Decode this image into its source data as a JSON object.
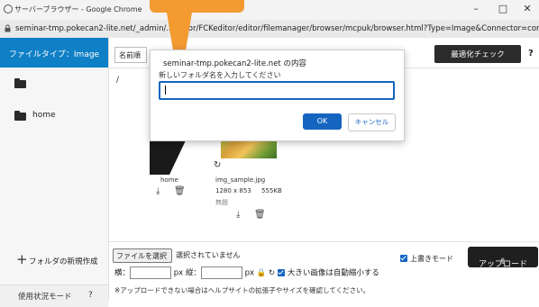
{
  "window": {
    "title": "サーバーブラウザー - Google Chrome",
    "minimize": "–",
    "maximize": "□",
    "close": "✕"
  },
  "urlbar": {
    "url": "seminar-tmp.pokecan2-lite.net/_admin/...editor/FCKeditor/editor/filemanager/browser/mcpuk/browser.html?Type=Image&Connector=con..."
  },
  "sidebar": {
    "filetype_label": "ファイルタイプ：Image",
    "items": [
      {
        "label": ""
      },
      {
        "label": "home"
      }
    ],
    "new_folder": "フォルダの新規作成",
    "usage_mode": "使用状況モード",
    "usage_help": "?"
  },
  "toolbar": {
    "name_label": "名前順",
    "optimize_label": "最適化チェック",
    "help": "?"
  },
  "breadcrumb": "/",
  "files": [
    {
      "name": "home"
    },
    {
      "name": "img_sample.jpg",
      "dimensions": "1280 x 853",
      "size": "555KB",
      "note": "無題"
    }
  ],
  "dialog": {
    "title": "seminar-tmp.pokecan2-lite.net の内容",
    "prompt": "新しいフォルダ名を入力してください",
    "input_value": "",
    "ok": "OK",
    "cancel": "キャンセル"
  },
  "bottom": {
    "choose_file": "ファイルを選択",
    "no_file": "選択されていません",
    "overwrite_mode": "上書きモード",
    "upload": "アップロード",
    "width_label": "横：",
    "height_label": "縦：",
    "px": "px",
    "auto_shrink": "大きい画像は自動縮小する",
    "notice": "※アップロードできない場合はヘルプサイトの拡張子やサイズを確認してください。"
  },
  "colors": {
    "accent": "#0f7fc6",
    "dialog_primary": "#1565c0",
    "callout": "#f39a31"
  }
}
